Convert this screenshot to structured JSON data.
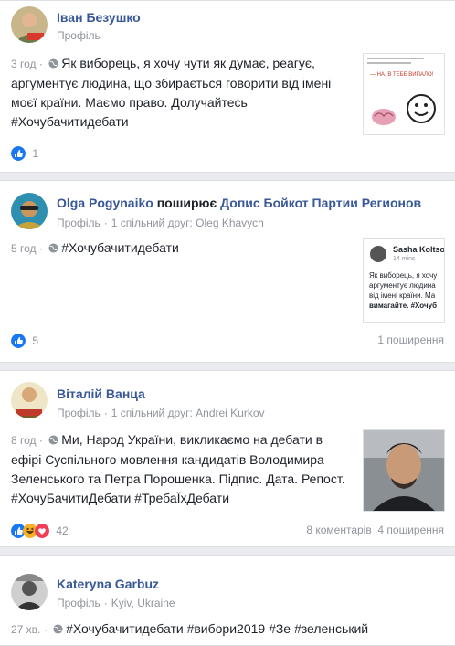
{
  "posts": [
    {
      "author": "Іван Безушко",
      "sub": "Профіль",
      "time": "3 год",
      "text_lines": [
        "Як виборець, я хочу чути як думає, реагує,",
        "аргументує людина, що збирається говорити від імені",
        "моєї країни. Маємо право. Долучайтесь",
        "#Хочубачитидебати"
      ],
      "thumb_caption": "— НА, В ТЕБЕ ВИПАЛО!",
      "reaction_count": "1"
    },
    {
      "author": "Olga Pogynaiko",
      "shares_word": "поширює",
      "shared_post": "Допис Бойкот Партии Регионов",
      "sub": "Профіль",
      "mutual": "1 спільний друг: Oleg Khavych",
      "time": "5 год",
      "text": "#Хочубачитидебати",
      "shared_card": {
        "name": "Sasha Koltso",
        "time": "14 mins",
        "lines": [
          "Як виборець, я хочу",
          "аргументує людина",
          "від імені країни. Ма",
          "вимагайте. #Хочуб"
        ]
      },
      "reaction_count": "5",
      "shares": "1 поширення"
    },
    {
      "author": "Віталій Ванца",
      "sub": "Профіль",
      "mutual": "1 спільний друг: Andrei Kurkov",
      "time": "8 год",
      "text_lines": [
        "Ми, Народ України, викликаємо на дебати в",
        "ефірі Суспільного мовлення кандидатів Володимира",
        "Зеленського та Петра Порошенка. Підпис. Дата. Репост.",
        "#ХочуБачитиДебати #ТребаЇхДебати"
      ],
      "reaction_count": "42",
      "comments": "8 коментарів",
      "shares": "4 поширення"
    },
    {
      "author": "Kateryna Garbuz",
      "sub": "Профіль",
      "location": "Kyiv, Ukraine",
      "time": "27 хв.",
      "text": "#Хочубачитидебати #вибори2019 #Зе #зеленський"
    }
  ],
  "colors": {
    "link": "#385898",
    "muted": "#90949c",
    "like": "#1877f2",
    "haha": "#f7b125",
    "love": "#f33e58"
  }
}
